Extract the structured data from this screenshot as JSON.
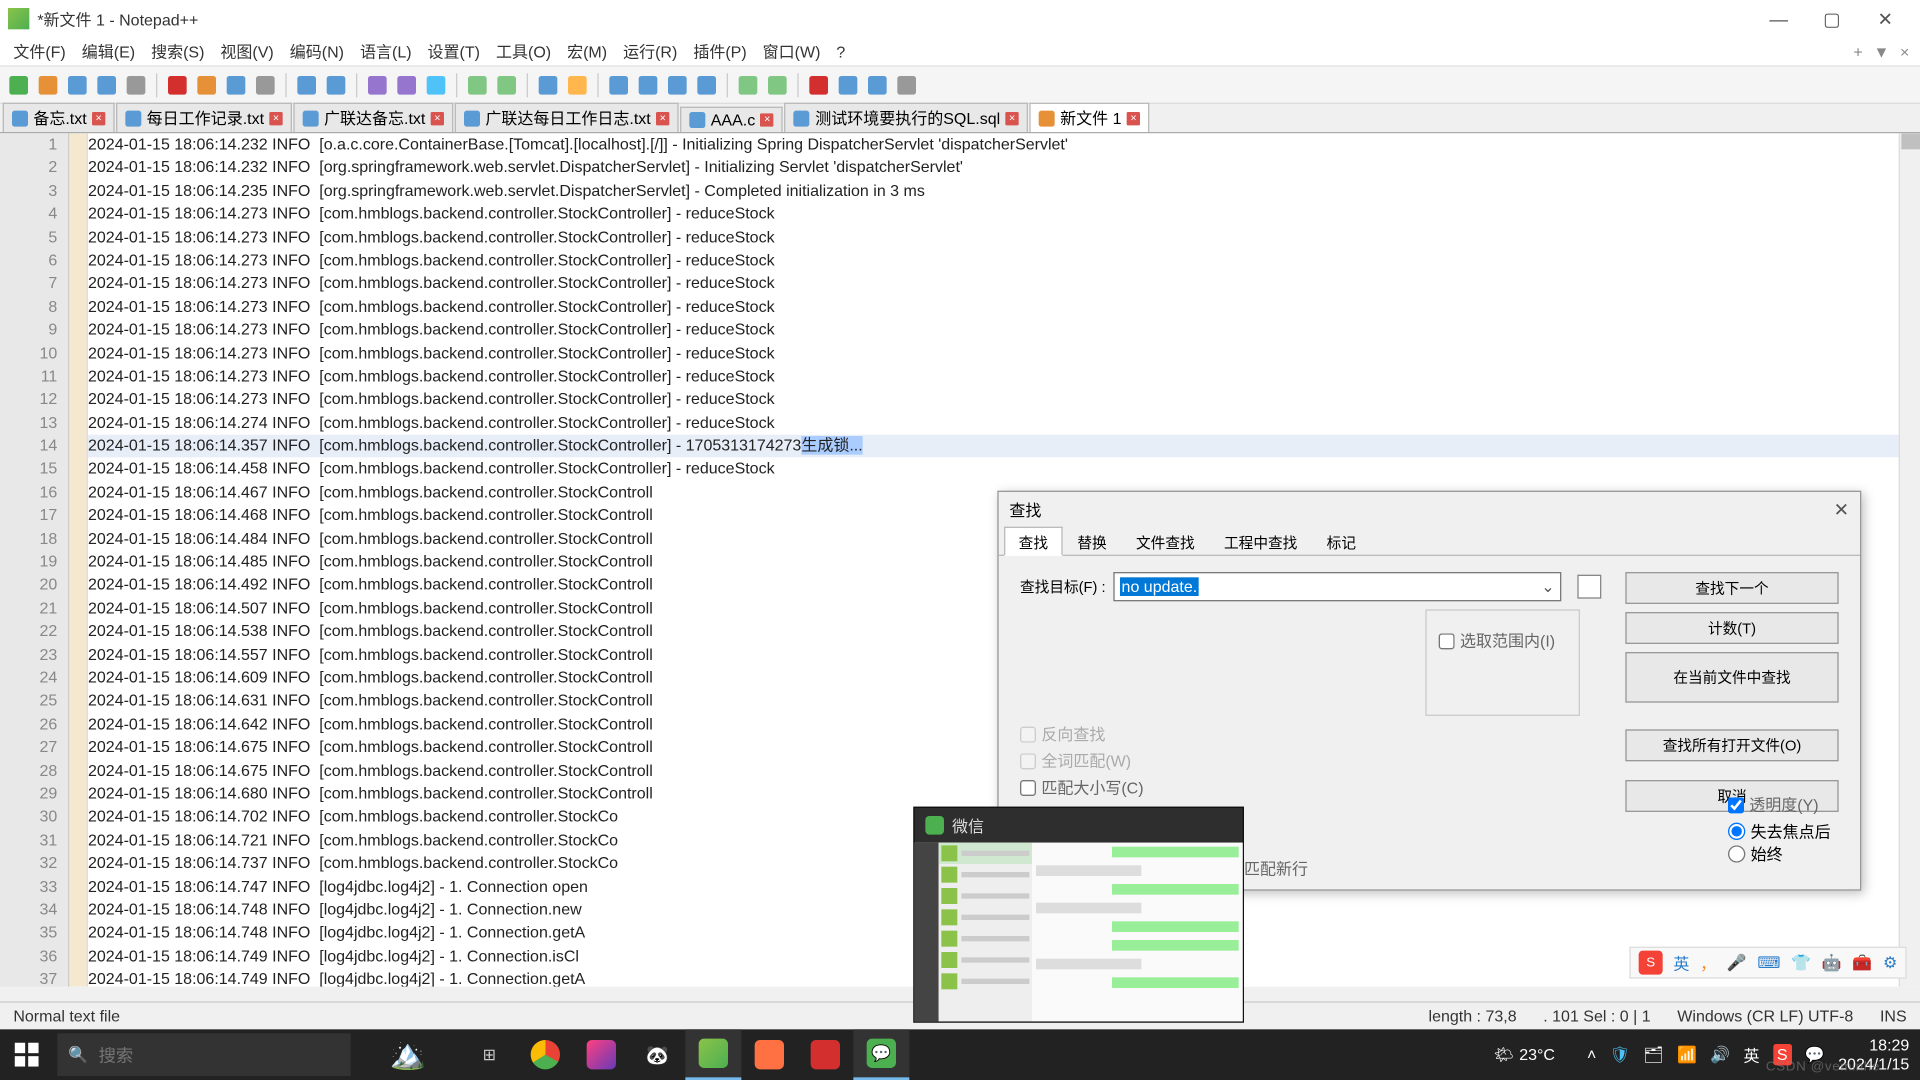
{
  "title": "*新文件 1 - Notepad++",
  "menus": [
    "文件(F)",
    "编辑(E)",
    "搜索(S)",
    "视图(V)",
    "编码(N)",
    "语言(L)",
    "设置(T)",
    "工具(O)",
    "宏(M)",
    "运行(R)",
    "插件(P)",
    "窗口(W)",
    "?"
  ],
  "menu_tail": [
    "+",
    "▼",
    "×"
  ],
  "tabs": [
    {
      "label": "备忘.txt",
      "active": false,
      "col": "blue"
    },
    {
      "label": "每日工作记录.txt",
      "active": false,
      "col": "blue"
    },
    {
      "label": "广联达备忘.txt",
      "active": false,
      "col": "blue"
    },
    {
      "label": "广联达每日工作日志.txt",
      "active": false,
      "col": "blue"
    },
    {
      "label": "AAA.c",
      "active": false,
      "col": "blue"
    },
    {
      "label": "测试环境要执行的SQL.sql",
      "active": false,
      "col": "blue"
    },
    {
      "label": "新文件 1",
      "active": true,
      "col": "orange"
    }
  ],
  "lines": [
    {
      "n": 1,
      "t": "2024-01-15 18:06:14.232 INFO  [o.a.c.core.ContainerBase.[Tomcat].[localhost].[/]] - Initializing Spring DispatcherServlet 'dispatcherServlet'"
    },
    {
      "n": 2,
      "t": "2024-01-15 18:06:14.232 INFO  [org.springframework.web.servlet.DispatcherServlet] - Initializing Servlet 'dispatcherServlet'"
    },
    {
      "n": 3,
      "t": "2024-01-15 18:06:14.235 INFO  [org.springframework.web.servlet.DispatcherServlet] - Completed initialization in 3 ms"
    },
    {
      "n": 4,
      "t": "2024-01-15 18:06:14.273 INFO  [com.hmblogs.backend.controller.StockController] - reduceStock"
    },
    {
      "n": 5,
      "t": "2024-01-15 18:06:14.273 INFO  [com.hmblogs.backend.controller.StockController] - reduceStock"
    },
    {
      "n": 6,
      "t": "2024-01-15 18:06:14.273 INFO  [com.hmblogs.backend.controller.StockController] - reduceStock"
    },
    {
      "n": 7,
      "t": "2024-01-15 18:06:14.273 INFO  [com.hmblogs.backend.controller.StockController] - reduceStock"
    },
    {
      "n": 8,
      "t": "2024-01-15 18:06:14.273 INFO  [com.hmblogs.backend.controller.StockController] - reduceStock"
    },
    {
      "n": 9,
      "t": "2024-01-15 18:06:14.273 INFO  [com.hmblogs.backend.controller.StockController] - reduceStock"
    },
    {
      "n": 10,
      "t": "2024-01-15 18:06:14.273 INFO  [com.hmblogs.backend.controller.StockController] - reduceStock"
    },
    {
      "n": 11,
      "t": "2024-01-15 18:06:14.273 INFO  [com.hmblogs.backend.controller.StockController] - reduceStock"
    },
    {
      "n": 12,
      "t": "2024-01-15 18:06:14.273 INFO  [com.hmblogs.backend.controller.StockController] - reduceStock"
    },
    {
      "n": 13,
      "t": "2024-01-15 18:06:14.274 INFO  [com.hmblogs.backend.controller.StockController] - reduceStock"
    },
    {
      "n": 14,
      "t": "2024-01-15 18:06:14.357 INFO  [com.hmblogs.backend.controller.StockController] - 1705313174273生成锁...",
      "hl": true
    },
    {
      "n": 15,
      "t": "2024-01-15 18:06:14.458 INFO  [com.hmblogs.backend.controller.StockController] - reduceStock"
    },
    {
      "n": 16,
      "t": "2024-01-15 18:06:14.467 INFO  [com.hmblogs.backend.controller.StockControll"
    },
    {
      "n": 17,
      "t": "2024-01-15 18:06:14.468 INFO  [com.hmblogs.backend.controller.StockControll"
    },
    {
      "n": 18,
      "t": "2024-01-15 18:06:14.484 INFO  [com.hmblogs.backend.controller.StockControll"
    },
    {
      "n": 19,
      "t": "2024-01-15 18:06:14.485 INFO  [com.hmblogs.backend.controller.StockControll"
    },
    {
      "n": 20,
      "t": "2024-01-15 18:06:14.492 INFO  [com.hmblogs.backend.controller.StockControll"
    },
    {
      "n": 21,
      "t": "2024-01-15 18:06:14.507 INFO  [com.hmblogs.backend.controller.StockControll"
    },
    {
      "n": 22,
      "t": "2024-01-15 18:06:14.538 INFO  [com.hmblogs.backend.controller.StockControll"
    },
    {
      "n": 23,
      "t": "2024-01-15 18:06:14.557 INFO  [com.hmblogs.backend.controller.StockControll"
    },
    {
      "n": 24,
      "t": "2024-01-15 18:06:14.609 INFO  [com.hmblogs.backend.controller.StockControll"
    },
    {
      "n": 25,
      "t": "2024-01-15 18:06:14.631 INFO  [com.hmblogs.backend.controller.StockControll"
    },
    {
      "n": 26,
      "t": "2024-01-15 18:06:14.642 INFO  [com.hmblogs.backend.controller.StockControll"
    },
    {
      "n": 27,
      "t": "2024-01-15 18:06:14.675 INFO  [com.hmblogs.backend.controller.StockControll"
    },
    {
      "n": 28,
      "t": "2024-01-15 18:06:14.675 INFO  [com.hmblogs.backend.controller.StockControll"
    },
    {
      "n": 29,
      "t": "2024-01-15 18:06:14.680 INFO  [com.hmblogs.backend.controller.StockControll"
    },
    {
      "n": 30,
      "t": "2024-01-15 18:06:14.702 INFO  [com.hmblogs.backend.controller.StockCo"
    },
    {
      "n": 31,
      "t": "2024-01-15 18:06:14.721 INFO  [com.hmblogs.backend.controller.StockCo"
    },
    {
      "n": 32,
      "t": "2024-01-15 18:06:14.737 INFO  [com.hmblogs.backend.controller.StockCo"
    },
    {
      "n": 33,
      "t": "2024-01-15 18:06:14.747 INFO  [log4jdbc.log4j2] - 1. Connection open"
    },
    {
      "n": 34,
      "t": "2024-01-15 18:06:14.748 INFO  [log4jdbc.log4j2] - 1. Connection.new "
    },
    {
      "n": 35,
      "t": "2024-01-15 18:06:14.748 INFO  [log4jdbc.log4j2] - 1. Connection.getA"
    },
    {
      "n": 36,
      "t": "2024-01-15 18:06:14.749 INFO  [log4jdbc.log4j2] - 1. Connection.isCl"
    },
    {
      "n": 37,
      "t": "2024-01-15 18:06:14.749 INFO  [log4jdbc.log4j2] - 1. Connection.getA"
    }
  ],
  "status": {
    "left": "Normal text file",
    "length": "length : 73,8",
    "pos": ". 101    Sel : 0 | 1",
    "enc": "Windows (CR LF)    UTF-8",
    "ins": "INS"
  },
  "find": {
    "title": "查找",
    "tabs": [
      "查找",
      "替换",
      "文件查找",
      "工程中查找",
      "标记"
    ],
    "target_label": "查找目标(F) :",
    "target_value": "no update.",
    "btn_next": "查找下一个",
    "btn_count": "计数(T)",
    "btn_curfile": "在当前文件中查找",
    "btn_allopen": "查找所有打开文件(O)",
    "btn_cancel": "取消",
    "chk_range": "选取范围内(I)",
    "chk_back": "反向查找",
    "chk_whole": "全词匹配(W)",
    "chk_case": "匹配大小写(C)",
    "chk_newline": "匹配新行",
    "trans_label": "透明度(Y)",
    "radio_lose": "失去焦点后",
    "radio_always": "始终"
  },
  "wechat": {
    "title": "微信"
  },
  "ime": {
    "lang": "英"
  },
  "weather": {
    "temp": "23°C"
  },
  "taskbar": {
    "search": "搜索"
  },
  "clock": {
    "time": "18:29",
    "date": "2024/1/15"
  },
  "watermark": "CSDN @veminhe"
}
